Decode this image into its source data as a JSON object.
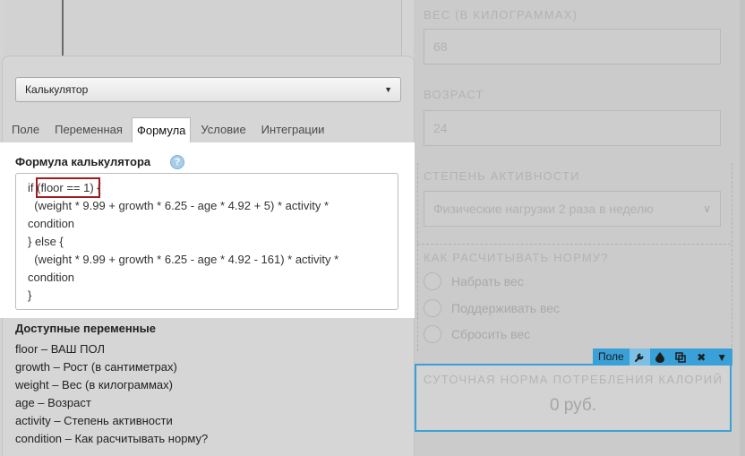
{
  "background_form": {
    "weight_label": "ВЕС (В КИЛОГРАММАХ)",
    "weight_value": "68",
    "age_label": "ВОЗРАСТ",
    "age_value": "24",
    "activity_label": "СТЕПЕНЬ АКТИВНОСТИ",
    "activity_value": "Физические нагрузки 2 раза в неделю",
    "norm_label": "КАК РАСЧИТЫВАТЬ НОРМУ?",
    "norm_options": [
      "Набрать вес",
      "Поддерживать вес",
      "Сбросить вес"
    ],
    "result_title": "СУТОЧНАЯ НОРМА ПОТРЕБЛЕНИЯ КАЛОРИЙ",
    "result_value": "0 руб."
  },
  "field_toolbar": {
    "label": "Поле",
    "icons": [
      "wrench-icon",
      "drop-icon",
      "copy-icon",
      "close-icon",
      "caret-down-icon"
    ],
    "active_color": "#39a0d8"
  },
  "panel": {
    "type_select": "Калькулятор",
    "tabs": [
      "Поле",
      "Переменная",
      "Формула",
      "Условие",
      "Интеграции"
    ],
    "active_tab": "Формула",
    "formula_title": "Формула калькулятора",
    "formula_lines": [
      "if (floor == 1) {",
      "  (weight * 9.99 + growth * 6.25 - age * 4.92 + 5) * activity *",
      "condition",
      "} else {",
      "  (weight * 9.99 + growth * 6.25 - age * 4.92 - 161) * activity *",
      "condition",
      "}"
    ],
    "vars_title": "Доступные переменные",
    "variables": [
      "floor – ВАШ ПОЛ",
      "growth – Рост (в сантиметрах)",
      "weight – Вес (в килограммах)",
      "age – Возраст",
      "activity – Степень активности",
      "condition – Как расчитывать норму?"
    ]
  }
}
